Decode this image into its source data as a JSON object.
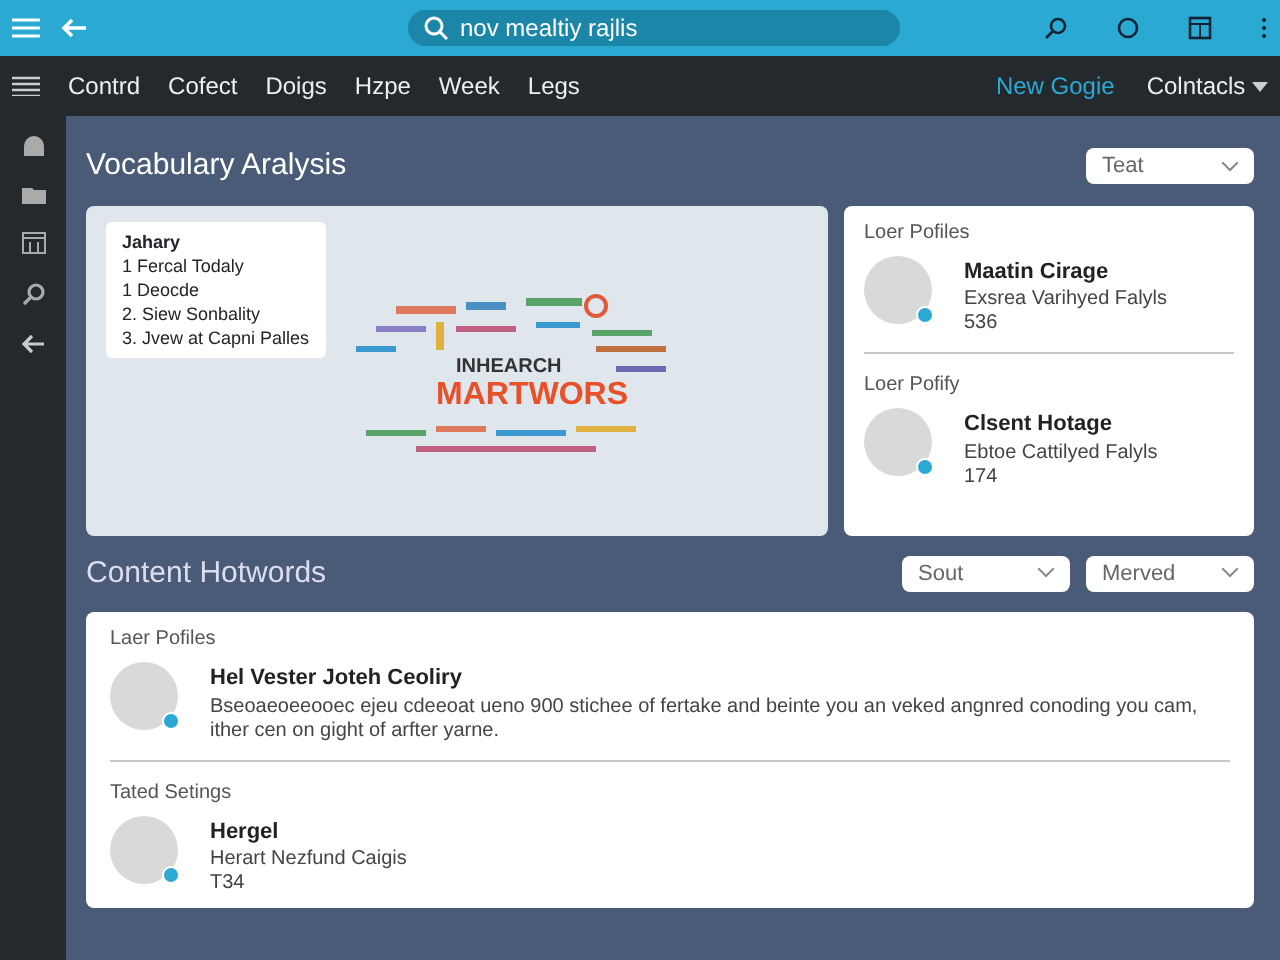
{
  "topbar": {
    "search": {
      "value": "nov mealtiy rajlis"
    }
  },
  "nav": {
    "items": [
      {
        "label": "Contrd",
        "selected": false
      },
      {
        "label": "Cofect",
        "selected": false
      },
      {
        "label": "Doigs",
        "selected": false
      },
      {
        "label": "Hzpe",
        "selected": false
      },
      {
        "label": "Week",
        "selected": false
      },
      {
        "label": "Legs",
        "selected": false
      }
    ],
    "link": "New Gogie",
    "menu": "Colntacls"
  },
  "vocabulary": {
    "title": "Vocabulary Aralysis",
    "select": "Teat",
    "callout": {
      "title": "Jahary",
      "items": [
        "1  Fercal Todaly",
        "1  Deocde",
        "2.  Siew Sonbality",
        "3.  Jvew at Capni Palles"
      ]
    },
    "cloud": {
      "small": "INHEARCH",
      "big": "MARTWORS"
    },
    "profiles": [
      {
        "section": "Loer Pofiles",
        "name": "Maatin Cirage",
        "desc": "Exsrea Varihyed Falyls",
        "count": "536"
      },
      {
        "section": "Loer Pofify",
        "name": "Clsent Hotage",
        "desc": "Ebtoe Cattilyed Falyls",
        "count": "174"
      }
    ]
  },
  "hotwords": {
    "title": "Content Hotwords",
    "selects": [
      "Sout",
      "Merved"
    ],
    "entries": [
      {
        "section": "Laer Pofiles",
        "name": "Hel Vester Joteh Ceoliry",
        "desc": "Bseoaeoeeooec ejeu cdeeoat ueno 900 stichee of fertake and beinte you an veked angnred conoding you cam, ither cen on gight of arfter yarne."
      },
      {
        "section": "Tated Setings",
        "name": "Hergel",
        "desc": "Herart Nezfund Caigis",
        "count": "T34"
      }
    ]
  }
}
